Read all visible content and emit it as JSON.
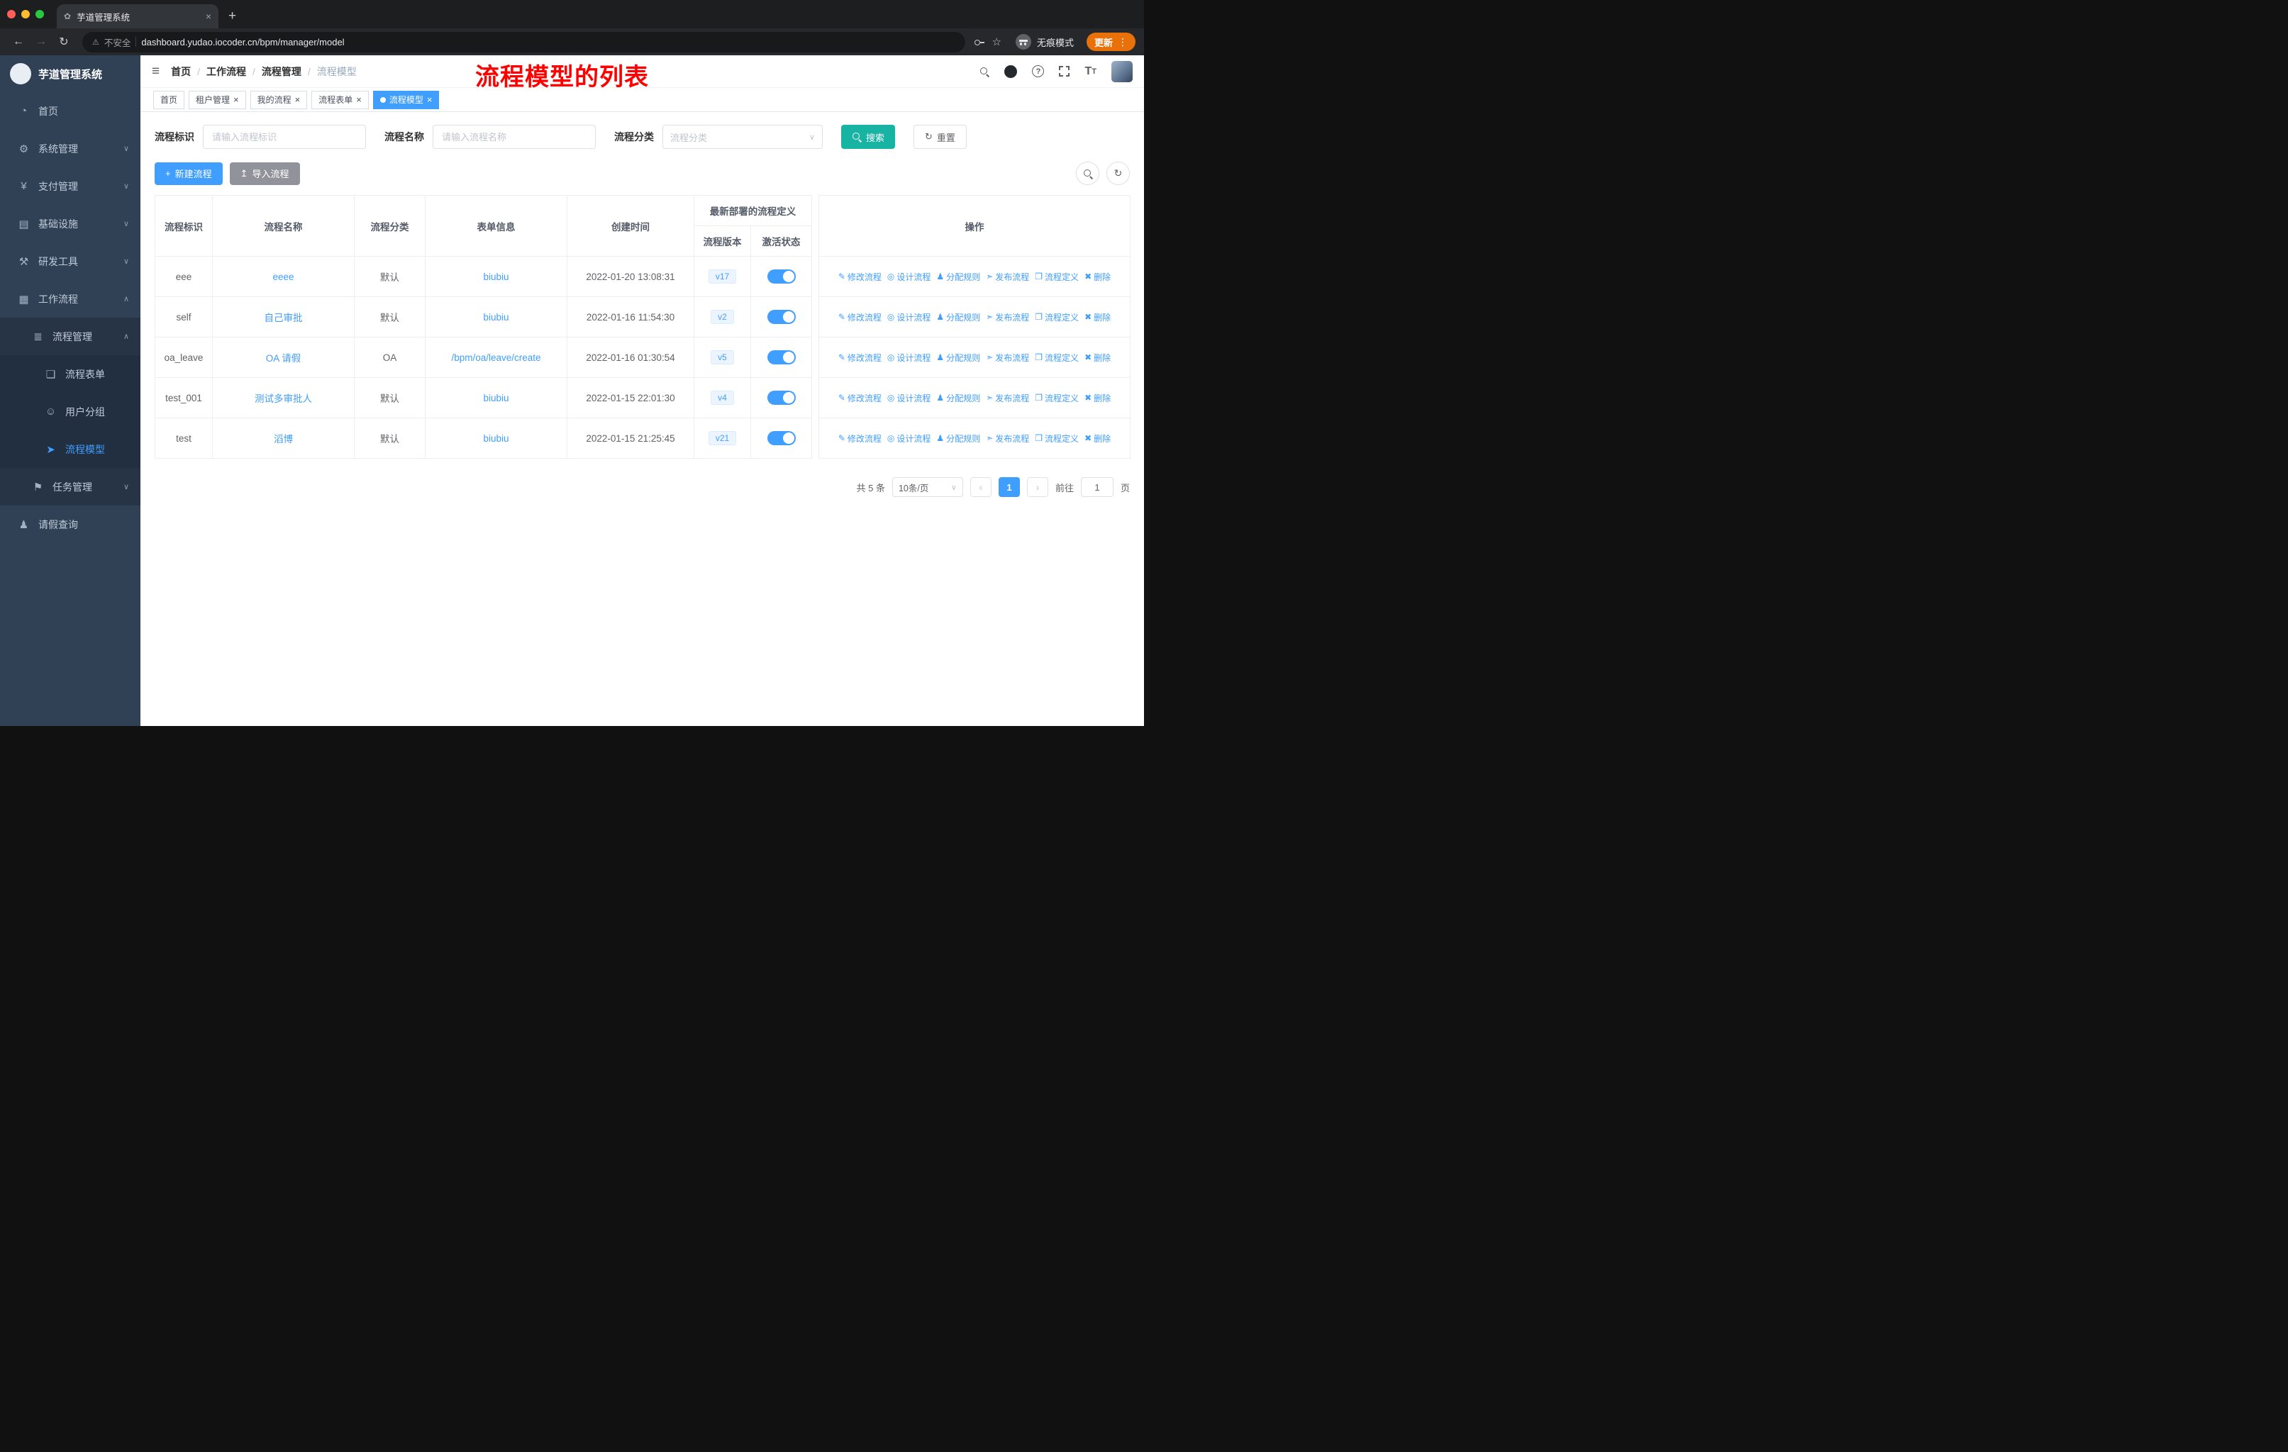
{
  "colors": {
    "primary": "#409eff",
    "teal": "#17b3a3",
    "info": "#909399",
    "red": "#ff0000",
    "update": "#e8710a",
    "sidebar": "#304156",
    "sidebar_sub": "#263445",
    "sidebar_sub2": "#212f40"
  },
  "glyphs": {
    "collapse": "≡",
    "question": "?",
    "font_size": "T",
    "font_size_small": "T",
    "refresh": "↻",
    "plus": "+",
    "upload": "↥",
    "chevron_down": "∨",
    "chevron_up": "∧",
    "select_arrow": "∨",
    "prev": "‹",
    "next": "›",
    "slash": "/",
    "close": "×"
  },
  "browser": {
    "tab": {
      "favicon": "✿",
      "title": "芋道管理系统",
      "close": "×"
    },
    "new_tab": "+",
    "nav": {
      "back": "←",
      "forward": "→",
      "reload": "↻"
    },
    "address": {
      "warning_icon": "⚠",
      "warning": "不安全",
      "url": "dashboard.yudao.iocoder.cn/bpm/manager/model"
    },
    "star": "☆",
    "incognito_label": "无痕模式",
    "update_button": "更新",
    "menu_dots": "⋮"
  },
  "sidebar": {
    "title": "芋道管理系统",
    "items": [
      {
        "label": "首页",
        "icon": "◔"
      },
      {
        "label": "系统管理",
        "icon": "⚙",
        "chevron": "∨"
      },
      {
        "label": "支付管理",
        "icon": "¥",
        "chevron": "∨"
      },
      {
        "label": "基础设施",
        "icon": "▤",
        "chevron": "∨"
      },
      {
        "label": "研发工具",
        "icon": "⚒",
        "chevron": "∨"
      },
      {
        "label": "工作流程",
        "icon": "▦",
        "chevron": "∧"
      },
      {
        "label": "流程管理",
        "icon": "≣",
        "chevron": "∧"
      },
      {
        "label": "流程表单",
        "icon": "❏"
      },
      {
        "label": "用户分组",
        "icon": "☺"
      },
      {
        "label": "流程模型",
        "icon": "➤"
      },
      {
        "label": "任务管理",
        "icon": "⚑",
        "chevron": "∨"
      },
      {
        "label": "请假查询",
        "icon": "♟"
      }
    ]
  },
  "header": {
    "breadcrumb": [
      "首页",
      "工作流程",
      "流程管理",
      "流程模型"
    ],
    "annotation": "流程模型的列表"
  },
  "tags": [
    {
      "label": "首页"
    },
    {
      "label": "租户管理"
    },
    {
      "label": "我的流程"
    },
    {
      "label": "流程表单"
    },
    {
      "label": "流程模型"
    }
  ],
  "filters": {
    "id_label": "流程标识",
    "id_placeholder": "请输入流程标识",
    "name_label": "流程名称",
    "name_placeholder": "请输入流程名称",
    "category_label": "流程分类",
    "category_placeholder": "流程分类",
    "search": "搜索",
    "reset": "重置"
  },
  "toolbar": {
    "create": "新建流程",
    "import": "导入流程"
  },
  "table": {
    "headers": {
      "id": "流程标识",
      "name": "流程名称",
      "category": "流程分类",
      "form": "表单信息",
      "created": "创建时间",
      "deploy_group": "最新部署的流程定义",
      "version": "流程版本",
      "active": "激活状态",
      "ops": "操作"
    },
    "actions": [
      {
        "name": "modify-process-link",
        "icon_name": "edit-icon",
        "glyph": "✎",
        "label": "修改流程"
      },
      {
        "name": "design-process-link",
        "icon_name": "design-icon",
        "glyph": "◎",
        "label": "设计流程"
      },
      {
        "name": "assign-rule-link",
        "icon_name": "user-icon",
        "glyph": "♟",
        "label": "分配规则"
      },
      {
        "name": "publish-process-link",
        "icon_name": "publish-icon",
        "glyph": "➣",
        "label": "发布流程"
      },
      {
        "name": "process-definition-link",
        "icon_name": "definition-icon",
        "glyph": "❐",
        "label": "流程定义"
      },
      {
        "name": "delete-link",
        "icon_name": "trash-icon",
        "glyph": "✖",
        "label": "删除"
      }
    ],
    "rows": [
      {
        "id": "eee",
        "name": "eeee",
        "category": "默认",
        "form": "biubiu",
        "created": "2022-01-20 13:08:31",
        "version": "v17"
      },
      {
        "id": "self",
        "name": "自己审批",
        "category": "默认",
        "form": "biubiu",
        "created": "2022-01-16 11:54:30",
        "version": "v2"
      },
      {
        "id": "oa_leave",
        "name": "OA 请假",
        "category": "OA",
        "form": "/bpm/oa/leave/create",
        "created": "2022-01-16 01:30:54",
        "version": "v5"
      },
      {
        "id": "test_001",
        "name": "测试多审批人",
        "category": "默认",
        "form": "biubiu",
        "created": "2022-01-15 22:01:30",
        "version": "v4"
      },
      {
        "id": "test",
        "name": "滔博",
        "category": "默认",
        "form": "biubiu",
        "created": "2022-01-15 21:25:45",
        "version": "v21"
      }
    ]
  },
  "pagination": {
    "total": "共 5 条",
    "page_size": "10条/页",
    "current": "1",
    "goto_label": "前往",
    "goto_value": "1",
    "page_unit": "页"
  }
}
